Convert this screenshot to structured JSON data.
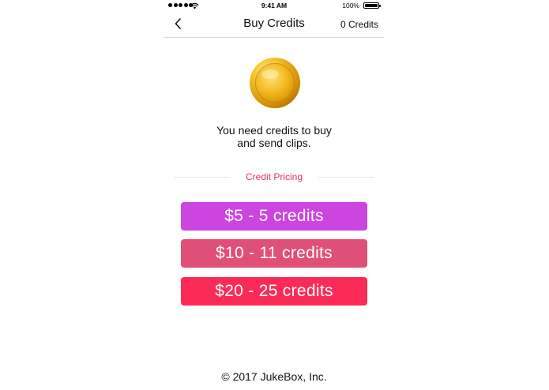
{
  "status_bar": {
    "time": "9:41 AM",
    "battery_percent": "100%",
    "signal_bars": 5,
    "battery_level": 1.0
  },
  "nav": {
    "back_icon": "chevron-left-icon",
    "title": "Buy Credits",
    "credits": "0 Credits"
  },
  "coin_icon": "gold-coin-icon",
  "message": {
    "line1": "You need credits to buy",
    "line2": "and send clips."
  },
  "pricing": {
    "label": "Credit Pricing",
    "options": [
      {
        "label": "$5 - 5 credits",
        "color": "#cc45e0"
      },
      {
        "label": "$10 - 11 credits",
        "color": "#e04f78"
      },
      {
        "label": "$20 - 25 credits",
        "color": "#fb2b57"
      }
    ]
  },
  "footer": {
    "copyright": "© 2017 JukeBox, Inc."
  }
}
